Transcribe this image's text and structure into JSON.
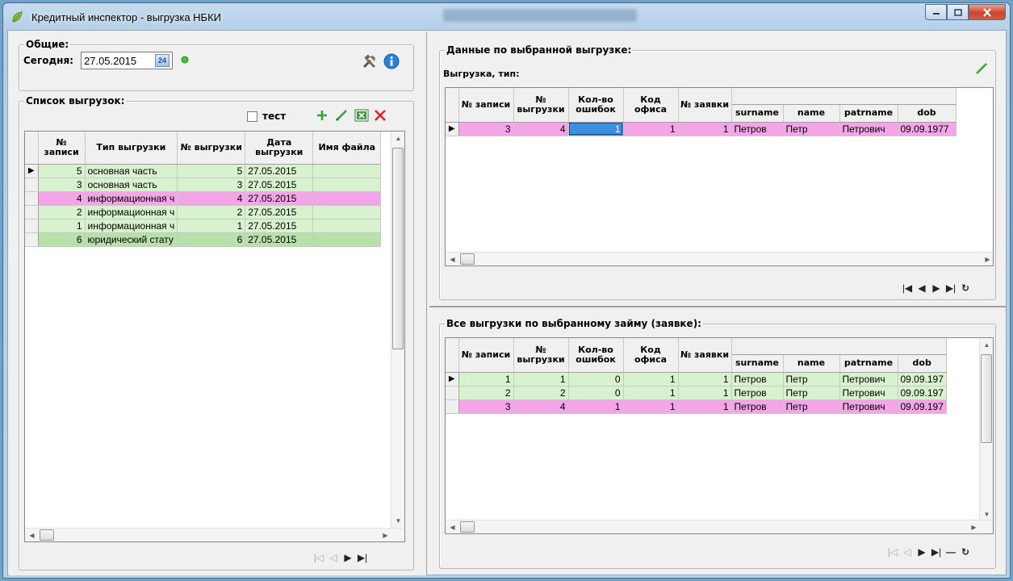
{
  "window": {
    "title": "Кредитный инспектор - выгрузка НБКИ"
  },
  "general": {
    "caption": "Общие:",
    "today_label": "Сегодня:",
    "today_value": "27.05.2015",
    "calendar_icon_text": "24"
  },
  "list": {
    "caption": "Список выгрузок:",
    "test_label": "тест",
    "headers": [
      "№ записи",
      "Тип выгрузки",
      "№ выгрузки",
      "Дата выгрузки",
      "Имя файла"
    ],
    "rows": [
      [
        "5",
        "основная часть",
        "5",
        "27.05.2015",
        ""
      ],
      [
        "3",
        "основная часть",
        "3",
        "27.05.2015",
        ""
      ],
      [
        "4",
        "информационная ч",
        "4",
        "27.05.2015",
        ""
      ],
      [
        "2",
        "информационная ч",
        "2",
        "27.05.2015",
        ""
      ],
      [
        "1",
        "информационная ч",
        "1",
        "27.05.2015",
        ""
      ],
      [
        "6",
        "юридический стату",
        "6",
        "27.05.2015",
        ""
      ]
    ]
  },
  "selected_upload": {
    "caption": "Данные по выбранной выгрузке:",
    "type_label": "Выгрузка, тип:",
    "headers": [
      "№ записи",
      "№ выгрузки",
      "Кол-во ошибок",
      "Код офиса",
      "№ заявки",
      "surname",
      "name",
      "patrname",
      "dob"
    ],
    "rows": [
      [
        "3",
        "4",
        "1",
        "1",
        "1",
        "Петров",
        "Петр",
        "Петрович",
        "09.09.1977"
      ]
    ]
  },
  "all_uploads": {
    "caption": "Все выгрузки по выбранному займу (заявке):",
    "headers": [
      "№ записи",
      "№ выгрузки",
      "Кол-во ошибок",
      "Код офиса",
      "№ заявки",
      "surname",
      "name",
      "patrname",
      "dob"
    ],
    "rows": [
      [
        "1",
        "1",
        "0",
        "1",
        "1",
        "Петров",
        "Петр",
        "Петрович",
        "09.09.197"
      ],
      [
        "2",
        "2",
        "0",
        "1",
        "1",
        "Петров",
        "Петр",
        "Петрович",
        "09.09.197"
      ],
      [
        "3",
        "4",
        "1",
        "1",
        "1",
        "Петров",
        "Петр",
        "Петрович",
        "09.09.197"
      ]
    ]
  },
  "colors": {
    "row_green": "#d7f2cc",
    "row_pink": "#f4a5e8",
    "row_dark_green": "#b8e0aa",
    "selection": "#3d8de0",
    "status_dot": "#3ec43e",
    "add_icon": "#2fa82f",
    "delete_icon": "#e0202a"
  }
}
